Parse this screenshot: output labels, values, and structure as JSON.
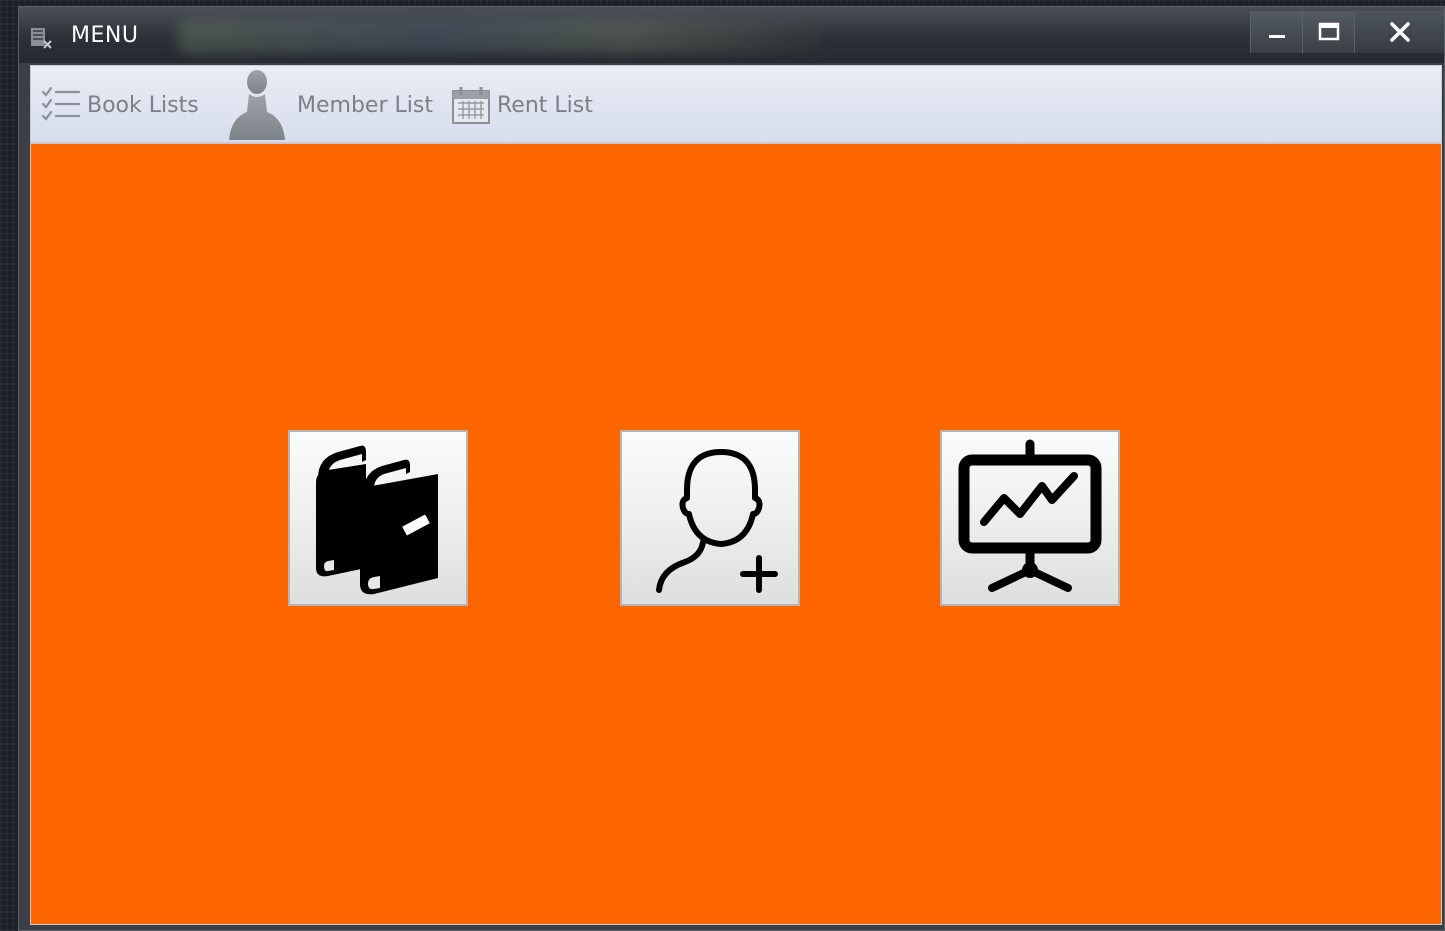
{
  "window": {
    "title": "MENU",
    "controls": [
      "minimize",
      "maximize",
      "close"
    ]
  },
  "toolbar": {
    "items": [
      {
        "label": "Book Lists",
        "icon": "checklist-icon"
      },
      {
        "label": "Member List",
        "icon": "person-silhouette-icon"
      },
      {
        "label": "Rent List",
        "icon": "calendar-icon"
      }
    ]
  },
  "main": {
    "background_color": "#ff6600",
    "buttons": [
      {
        "name": "books-button",
        "icon": "books-icon"
      },
      {
        "name": "add-member-button",
        "icon": "add-user-icon"
      },
      {
        "name": "statistics-button",
        "icon": "presentation-chart-icon"
      }
    ]
  }
}
